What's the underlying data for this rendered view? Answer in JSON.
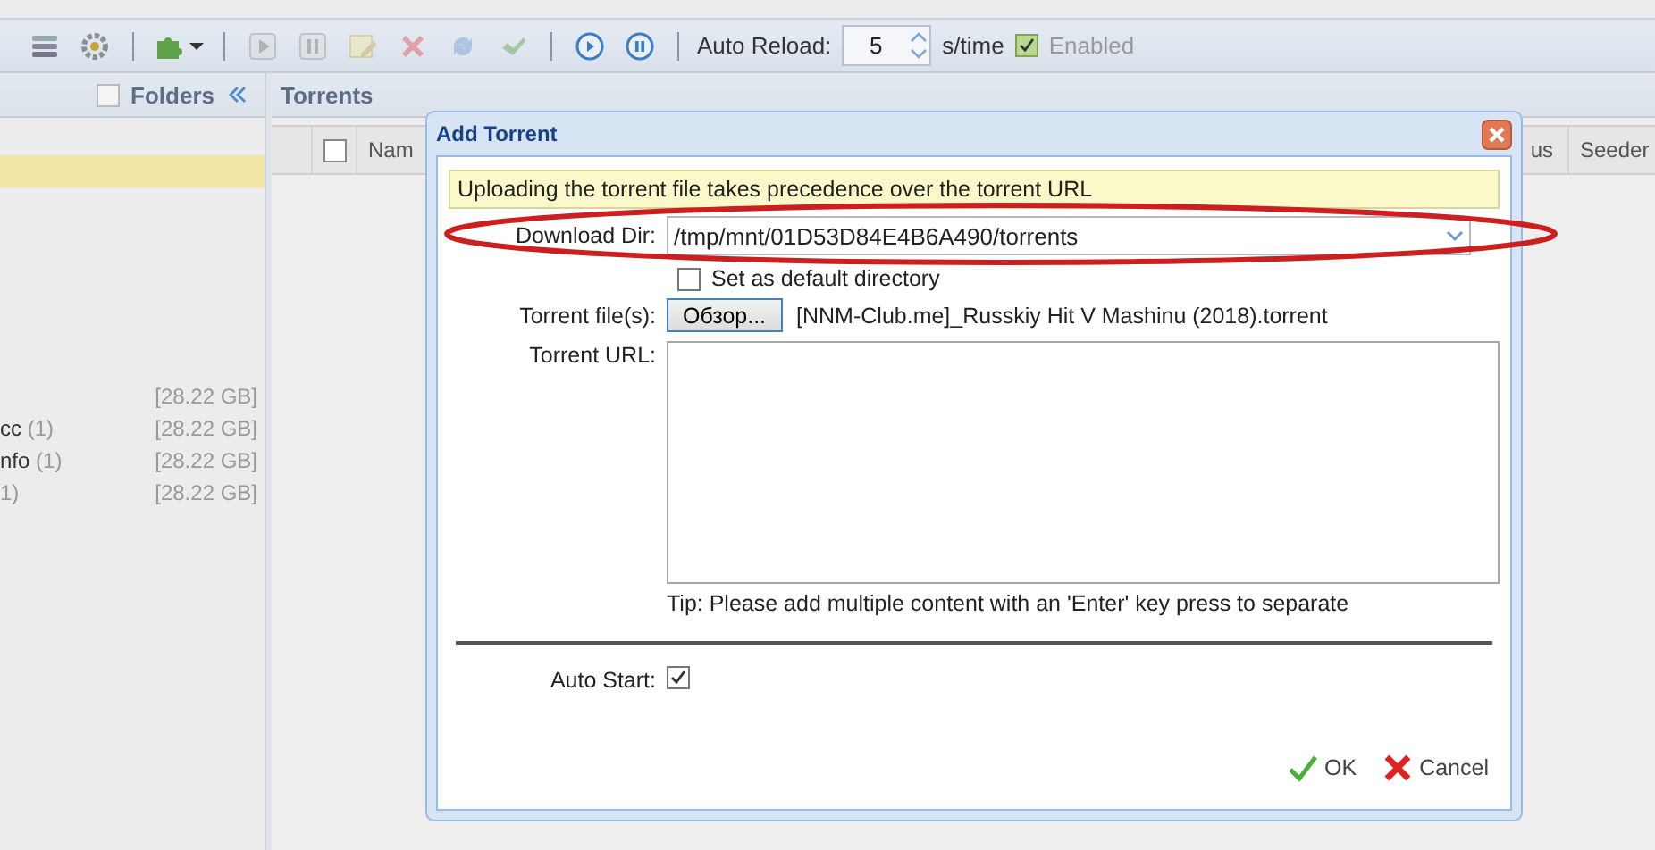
{
  "toolbar": {
    "items": [
      {
        "kind": "button",
        "disabled": false
      },
      {
        "kind": "button",
        "disabled": false
      },
      {
        "kind": "separator"
      },
      {
        "kind": "menu",
        "disabled": false
      },
      {
        "kind": "separator"
      },
      {
        "kind": "button",
        "disabled": true
      },
      {
        "kind": "button",
        "disabled": true
      },
      {
        "kind": "button",
        "disabled": true
      },
      {
        "kind": "button",
        "disabled": true
      },
      {
        "kind": "button",
        "disabled": true
      },
      {
        "kind": "button",
        "disabled": true
      },
      {
        "kind": "separator"
      },
      {
        "kind": "button",
        "disabled": false
      },
      {
        "kind": "button",
        "disabled": false
      },
      {
        "kind": "separator"
      }
    ],
    "auto_reload": {
      "label": "Auto Reload:",
      "value": "5",
      "unit": "s/time"
    },
    "enabled": {
      "label": "Enabled",
      "checked": true,
      "disabled": true
    }
  },
  "folders_panel": {
    "title": "Folders",
    "checked": false,
    "items": [
      {
        "selected": true
      },
      {
        "selected": false,
        "size": "[28.22 GB]"
      },
      {
        "selected": false,
        "name": "cc",
        "count": "(1)",
        "size": "[28.22 GB]"
      },
      {
        "selected": false,
        "name": "nfo",
        "count": "(1)",
        "size": "[28.22 GB]"
      },
      {
        "selected": false,
        "count": "1)",
        "size": "[28.22 GB]"
      }
    ]
  },
  "torrents_panel": {
    "title": "Torrents",
    "select_all_checked": false,
    "columns": [
      {
        "label": "Nam"
      },
      {
        "label": "us"
      },
      {
        "label": "Seeder"
      }
    ]
  },
  "dialog": {
    "title": "Add Torrent",
    "notice": "Uploading the torrent file takes precedence over the torrent URL",
    "download_dir": {
      "label": "Download Dir:",
      "value": "/tmp/mnt/01D53D84E4B6A490/torrents"
    },
    "set_default": {
      "label": "Set as default directory",
      "checked": false
    },
    "torrent_files": {
      "label": "Torrent file(s):",
      "button": "Обзор...",
      "file_name": "[NNM-Club.me]_Russkiy Hit V Mashinu (2018).torrent"
    },
    "torrent_url": {
      "label": "Torrent URL:"
    },
    "tip": "Tip: Please add multiple content with an 'Enter' key press to separate",
    "auto_start": {
      "label": "Auto Start:",
      "checked": true
    },
    "buttons": [
      {
        "kind": "ok",
        "label": "OK"
      },
      {
        "kind": "cancel",
        "label": "Cancel"
      }
    ]
  }
}
